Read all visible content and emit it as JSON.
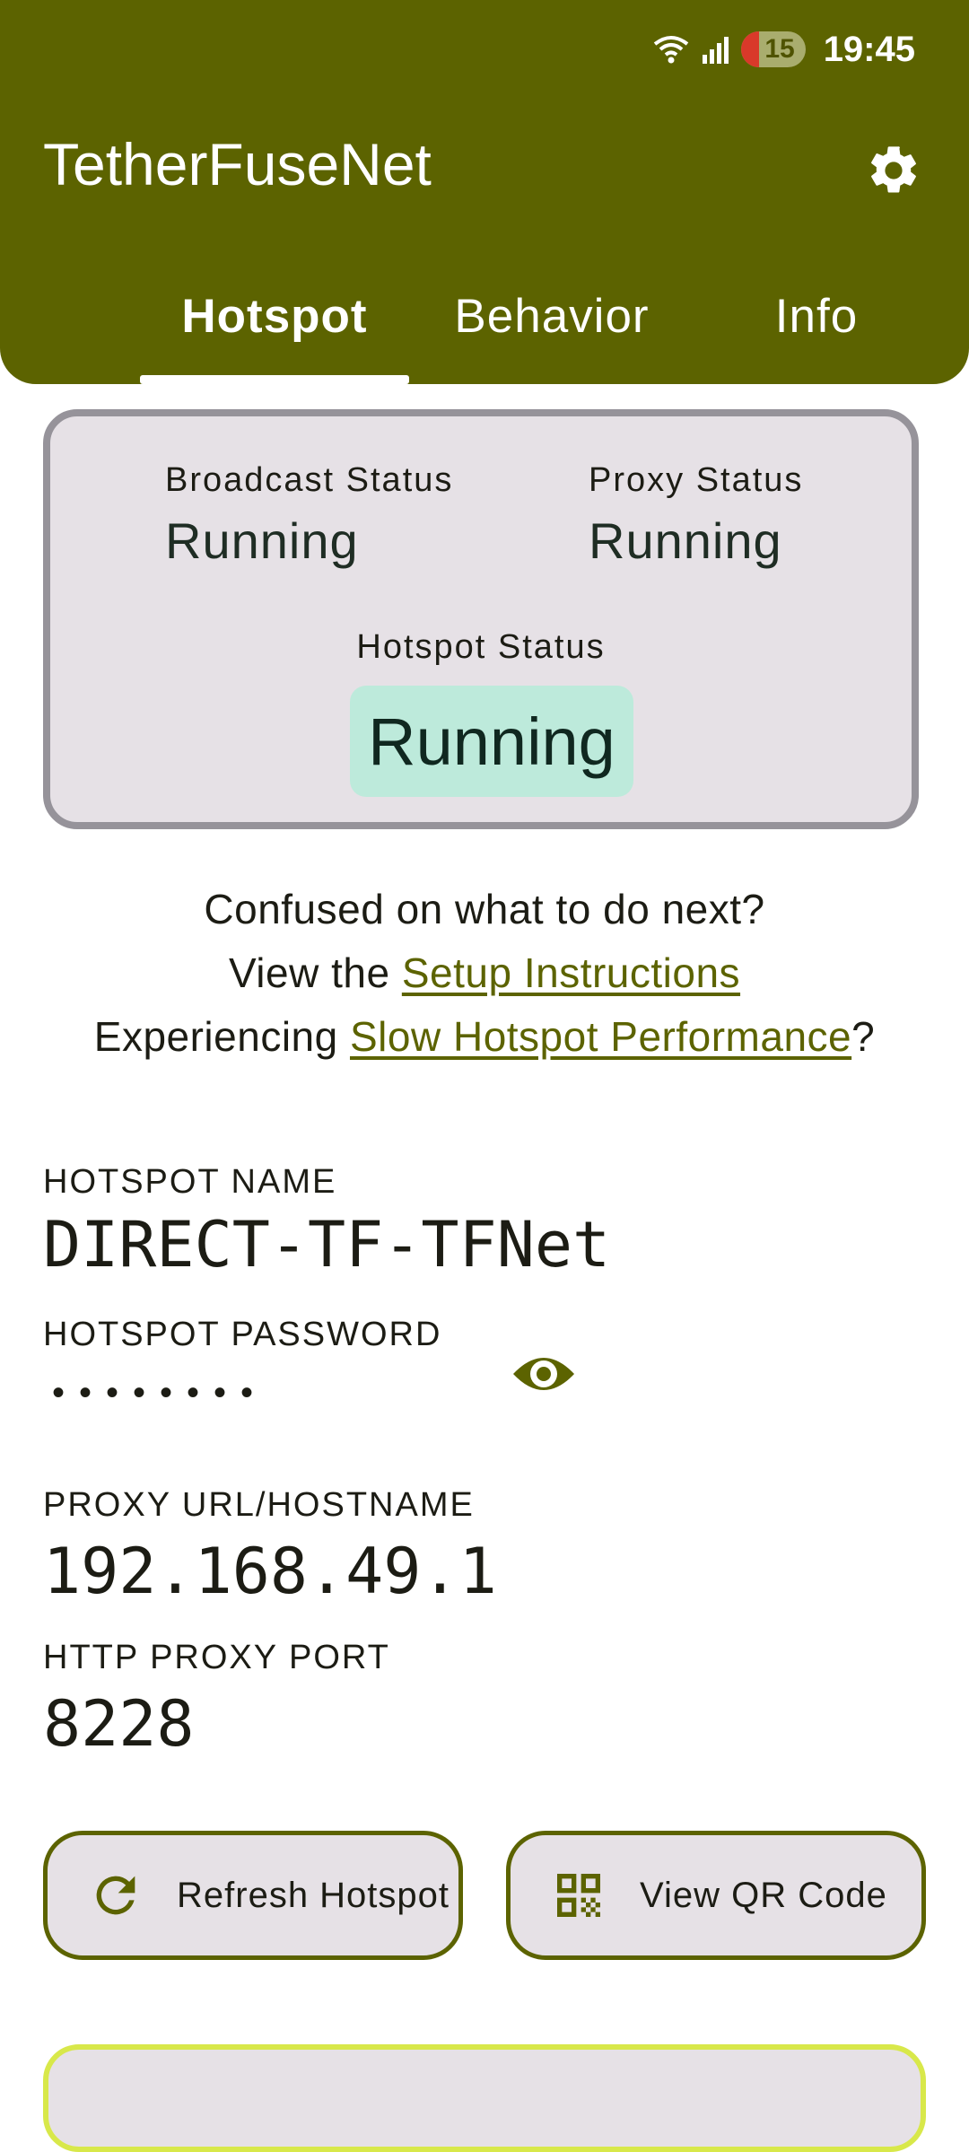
{
  "status_bar": {
    "time": "19:45",
    "battery": "15"
  },
  "app": {
    "title": "TetherFuseNet"
  },
  "tabs": [
    {
      "label": "Hotspot",
      "active": true
    },
    {
      "label": "Behavior",
      "active": false
    },
    {
      "label": "Info",
      "active": false
    }
  ],
  "status": {
    "broadcast_label": "Broadcast Status",
    "broadcast_value": "Running",
    "proxy_label": "Proxy Status",
    "proxy_value": "Running",
    "hotspot_label": "Hotspot Status",
    "hotspot_value": "Running"
  },
  "help": {
    "line1": "Confused on what to do next?",
    "line2_prefix": "View the ",
    "setup_link": "Setup Instructions",
    "line3_prefix": "Experiencing ",
    "slow_link": "Slow Hotspot Performance",
    "line3_suffix": "?"
  },
  "details": {
    "name_label": "HOTSPOT NAME",
    "name_value": "DIRECT-TF-TFNet",
    "password_label": "HOTSPOT PASSWORD",
    "password_masked": "••••••••",
    "proxy_label": "PROXY URL/HOSTNAME",
    "proxy_value": "192.168.49.1",
    "port_label": "HTTP PROXY PORT",
    "port_value": "8228"
  },
  "buttons": {
    "refresh": "Refresh Hotspot",
    "qr": "View QR Code"
  },
  "icons": {
    "settings": "gear-icon",
    "visibility": "eye-icon",
    "refresh": "refresh-icon",
    "qr": "qr-code-icon"
  },
  "colors": {
    "primary": "#5c6300",
    "card_background": "#e6e1e6",
    "running_pill": "#bdeadb",
    "bottom_card_border": "#d8e84a"
  }
}
